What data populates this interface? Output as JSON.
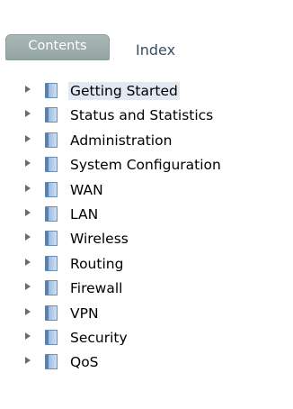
{
  "tabs": {
    "contents_label": "Contents",
    "index_label": "Index"
  },
  "tree": {
    "items": [
      {
        "label": "Getting Started",
        "selected": true
      },
      {
        "label": "Status and Statistics"
      },
      {
        "label": "Administration"
      },
      {
        "label": "System Configuration"
      },
      {
        "label": "WAN"
      },
      {
        "label": "LAN"
      },
      {
        "label": "Wireless"
      },
      {
        "label": "Routing"
      },
      {
        "label": "Firewall"
      },
      {
        "label": "VPN"
      },
      {
        "label": "Security"
      },
      {
        "label": "QoS"
      }
    ],
    "icons": {
      "expander": "triangle-right-icon",
      "node": "book-icon"
    }
  },
  "colors": {
    "tab_active_bg": "#9fb0ad",
    "tab_inactive_text": "#3a4d63",
    "selection_bg": "#e3e9f1",
    "book_icon": "#7fa6d4"
  }
}
